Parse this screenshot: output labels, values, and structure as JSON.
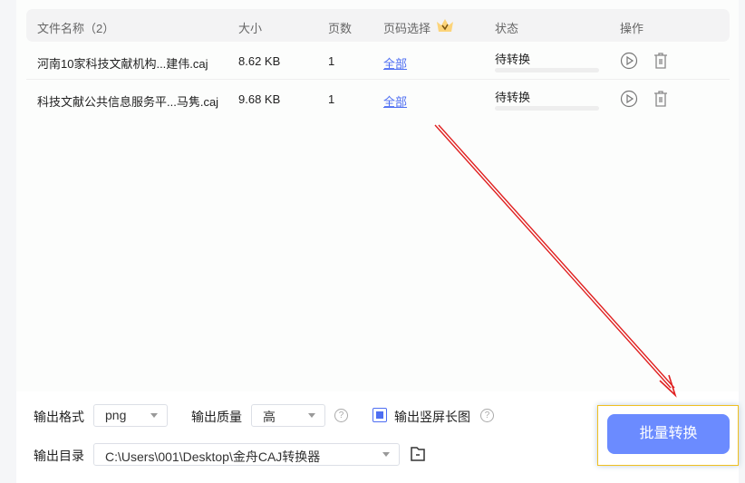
{
  "table": {
    "headers": {
      "name": "文件名称（2）",
      "size": "大小",
      "pages": "页数",
      "range": "页码选择",
      "status": "状态",
      "actions": "操作"
    },
    "rows": [
      {
        "name": "河南10家科技文献机构...建伟.caj",
        "size": "8.62 KB",
        "pages": "1",
        "range": "全部",
        "status": "待转换",
        "progress": 0
      },
      {
        "name": "科技文献公共信息服务平...马隽.caj",
        "size": "9.68 KB",
        "pages": "1",
        "range": "全部",
        "status": "待转换",
        "progress": 0
      }
    ]
  },
  "options": {
    "format_label": "输出格式",
    "format_value": "png",
    "quality_label": "输出质量",
    "quality_value": "高",
    "long_image_label": "输出竖屏长图",
    "long_image_checked": true,
    "dir_label": "输出目录",
    "dir_value": "C:\\Users\\001\\Desktop\\金舟CAJ转换器"
  },
  "convert_button": "批量转换",
  "colors": {
    "accent": "#6b8bff",
    "link": "#4e6ef2",
    "arrow": "#e02020"
  }
}
